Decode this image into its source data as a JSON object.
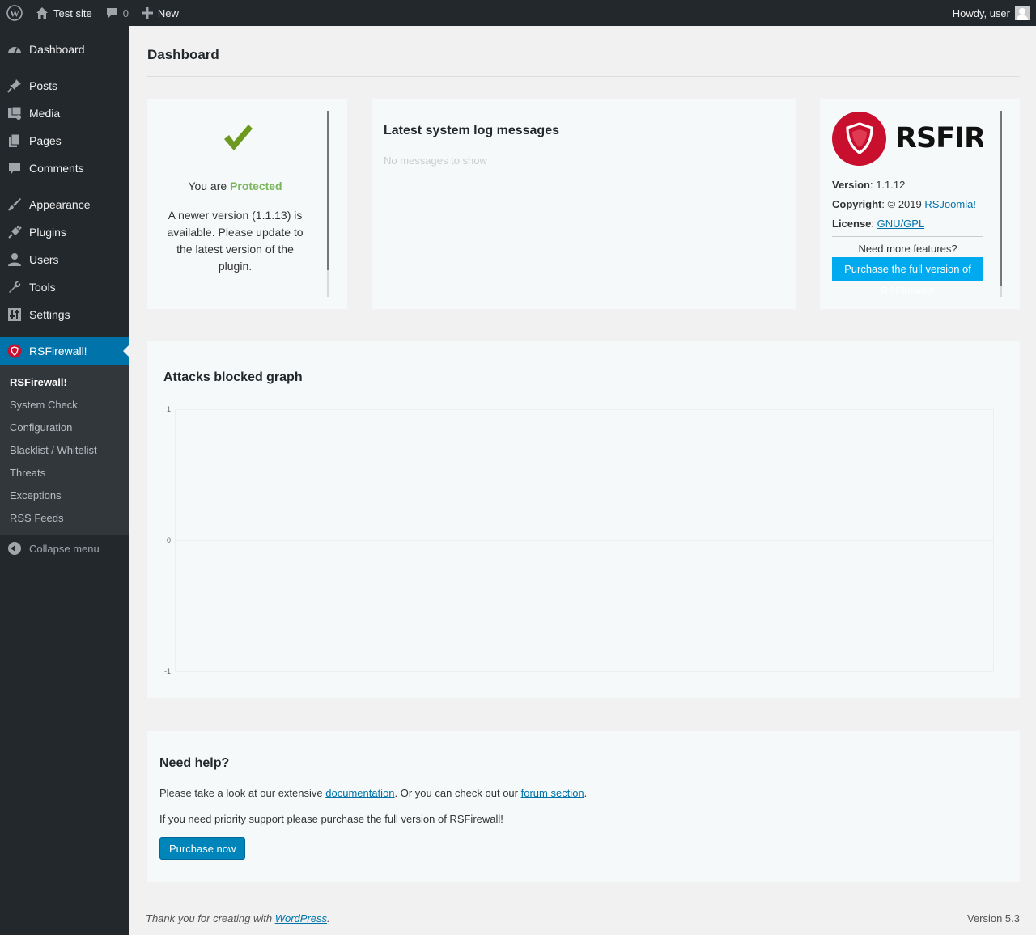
{
  "admin_bar": {
    "site_name": "Test site",
    "comments_count": "0",
    "new_label": "New",
    "howdy": "Howdy, user"
  },
  "sidebar": {
    "items": [
      {
        "label": "Dashboard",
        "icon": "dashboard-icon"
      },
      {
        "label": "Posts",
        "icon": "pin-icon"
      },
      {
        "label": "Media",
        "icon": "media-icon"
      },
      {
        "label": "Pages",
        "icon": "pages-icon"
      },
      {
        "label": "Comments",
        "icon": "comments-icon"
      },
      {
        "label": "Appearance",
        "icon": "brush-icon"
      },
      {
        "label": "Plugins",
        "icon": "plug-icon"
      },
      {
        "label": "Users",
        "icon": "user-icon"
      },
      {
        "label": "Tools",
        "icon": "wrench-icon"
      },
      {
        "label": "Settings",
        "icon": "settings-icon"
      },
      {
        "label": "RSFirewall!",
        "icon": "rsfirewall-shield-icon"
      }
    ],
    "submenu": [
      "RSFirewall!",
      "System Check",
      "Configuration",
      "Blacklist / Whitelist",
      "Threats",
      "Exceptions",
      "RSS Feeds"
    ],
    "collapse_label": "Collapse menu"
  },
  "page": {
    "title": "Dashboard"
  },
  "status_panel": {
    "prefix": "You are",
    "status": "Protected",
    "update_message": "A newer version (1.1.13) is available. Please update to the latest version of the plugin."
  },
  "log_panel": {
    "title": "Latest system log messages",
    "empty": "No messages to show"
  },
  "about_panel": {
    "brand": "RSFIREWALL!",
    "version_label": "Version",
    "version_value": "1.1.12",
    "copyright_label": "Copyright",
    "copyright_value": "© 2019",
    "copyright_link": "RSJoomla!",
    "license_label": "License",
    "license_link": "GNU/GPL",
    "more_features": "Need more features?",
    "purchase_full": "Purchase the full version of RSFirewall!"
  },
  "graph_panel": {
    "title": "Attacks blocked graph"
  },
  "chart_data": {
    "type": "line",
    "title": "Attacks blocked graph",
    "series": [],
    "ylim": [
      -1,
      1
    ],
    "yticks": [
      "1",
      "0",
      "-1"
    ],
    "grid": true
  },
  "help_panel": {
    "title": "Need help?",
    "p1_start": "Please take a look at our extensive",
    "p1_link1": "documentation",
    "p1_mid": ". Or you can check out our",
    "p1_link2": "forum section",
    "p1_end": ".",
    "p2": "If you need priority support please purchase the full version of RSFirewall!",
    "button": "Purchase now"
  },
  "footer": {
    "thanks_prefix": "Thank you for creating with",
    "thanks_link": "WordPress",
    "thanks_suffix": ".",
    "version": "Version 5.3"
  },
  "colors": {
    "admin_bg": "#23282d",
    "accent": "#0073aa",
    "protected": "#7ab55c",
    "brand_red": "#c8102e",
    "purchase_blue": "#00aaee"
  }
}
